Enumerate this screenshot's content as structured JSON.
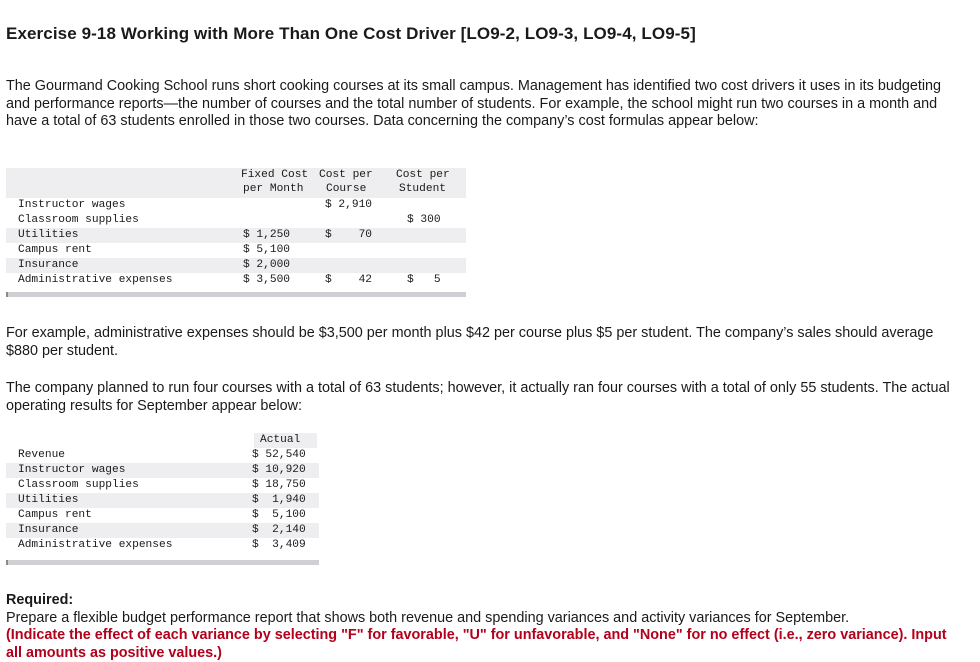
{
  "title": "Exercise 9-18 Working with More Than One Cost Driver [LO9-2, LO9-3, LO9-4, LO9-5]",
  "intro": "The Gourmand Cooking School runs short cooking courses at its small campus. Management has identified two cost drivers it uses in its budgeting and performance reports—the number of courses and the total number of students. For example, the school might run two courses in a month and have a total of 63 students enrolled in those two courses. Data concerning the company’s cost formulas appear below:",
  "cost_table": {
    "headers": {
      "fixed": [
        "Fixed Cost",
        "per Month"
      ],
      "course": [
        "Cost per",
        "Course"
      ],
      "student": [
        "Cost per",
        "Student"
      ]
    },
    "rows": [
      {
        "label": "Instructor wages",
        "fixed": "",
        "course": "$ 2,910",
        "student": ""
      },
      {
        "label": "Classroom supplies",
        "fixed": "",
        "course": "",
        "student": "$ 300"
      },
      {
        "label": "Utilities",
        "fixed": "$ 1,250",
        "course": "$    70",
        "student": ""
      },
      {
        "label": "Campus rent",
        "fixed": "$ 5,100",
        "course": "",
        "student": ""
      },
      {
        "label": "Insurance",
        "fixed": "$ 2,000",
        "course": "",
        "student": ""
      },
      {
        "label": "Administrative expenses",
        "fixed": "$ 3,500",
        "course": "$    42",
        "student": "$   5"
      }
    ]
  },
  "example": "For example, administrative expenses should be $3,500 per month plus $42 per course plus $5 per student. The company’s sales should average $880 per student.",
  "planned": "The company planned to run four courses with a total of 63 students; however, it actually ran four courses with a total of only 55 students. The actual operating results for September appear below:",
  "actual_table": {
    "header": "Actual",
    "rows": [
      {
        "label": "Revenue",
        "value": "$ 52,540"
      },
      {
        "label": "Instructor wages",
        "value": "$ 10,920"
      },
      {
        "label": "Classroom supplies",
        "value": "$ 18,750"
      },
      {
        "label": "Utilities",
        "value": "$  1,940"
      },
      {
        "label": "Campus rent",
        "value": "$  5,100"
      },
      {
        "label": "Insurance",
        "value": "$  2,140"
      },
      {
        "label": "Administrative expenses",
        "value": "$  3,409"
      }
    ]
  },
  "required": {
    "label": "Required:",
    "text": "Prepare a flexible budget performance report that shows both revenue and spending variances and activity variances for September.",
    "instruction": "(Indicate the effect of each variance by selecting \"F\" for favorable, \"U\" for unfavorable, and \"None\" for no effect (i.e., zero variance). Input all amounts as positive values.)"
  }
}
